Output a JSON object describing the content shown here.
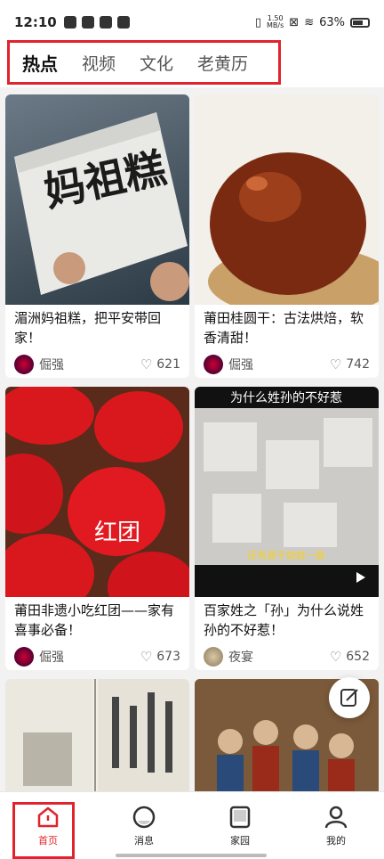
{
  "status": {
    "time": "12:10",
    "net_speed": "1.50",
    "net_unit": "MB/s",
    "battery": "63%"
  },
  "tabs": [
    {
      "label": "热点",
      "active": true
    },
    {
      "label": "视频",
      "active": false
    },
    {
      "label": "文化",
      "active": false
    },
    {
      "label": "老黄历",
      "active": false
    }
  ],
  "cards": [
    {
      "title": "湄洲妈祖糕，把平安带回家！",
      "author": "倔强",
      "likes": "621",
      "img_text": "妈祖糕"
    },
    {
      "title": "莆田桂圆干：古法烘焙，软香清甜！",
      "author": "倔强",
      "likes": "742"
    },
    {
      "title": "莆田非遗小吃红团——家有喜事必备！",
      "author": "倔强",
      "likes": "673",
      "img_text": "红团"
    },
    {
      "title": "百家姓之「孙」为什么说姓孙的不好惹！",
      "author": "夜宴",
      "likes": "652",
      "img_caption_top": "为什么姓孙的不好惹",
      "img_caption_bottom": "还有源于妫姓一脉"
    }
  ],
  "nav": [
    {
      "label": "首页",
      "active": true
    },
    {
      "label": "消息",
      "active": false
    },
    {
      "label": "家园",
      "active": false
    },
    {
      "label": "我的",
      "active": false
    }
  ],
  "colors": {
    "accent": "#e1232b"
  }
}
